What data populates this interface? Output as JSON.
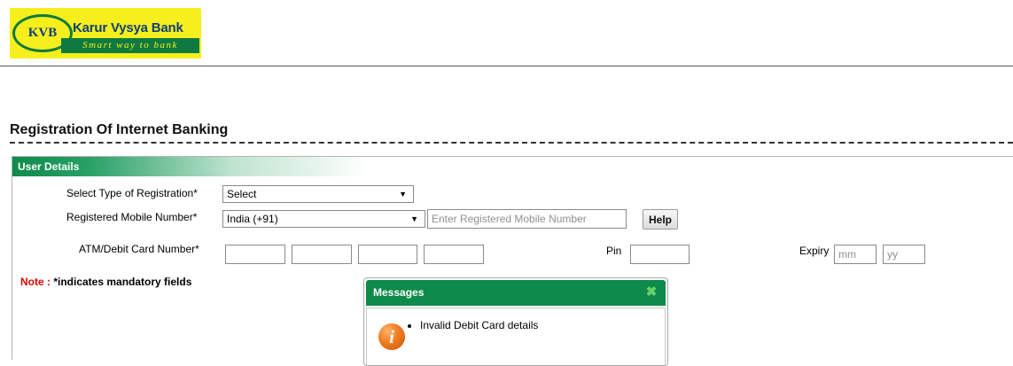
{
  "logo": {
    "badge": "KVB",
    "name": "Karur Vysya Bank",
    "tagline": "Smart way to bank"
  },
  "page_title": "Registration Of Internet Banking",
  "panel": {
    "title": "User Details"
  },
  "form": {
    "registration_type": {
      "label": "Select Type of Registration*",
      "value": "Select"
    },
    "mobile": {
      "label": "Registered Mobile Number*",
      "country_value": "India (+91)",
      "placeholder": "Enter Registered Mobile Number",
      "help_label": "Help"
    },
    "card": {
      "label": "ATM/Debit Card Number*",
      "pin_label": "Pin",
      "expiry_label": "Expiry",
      "month_placeholder": "mm",
      "year_placeholder": "yy"
    },
    "note": {
      "key": "Note :",
      "text": " *indicates mandatory fields"
    }
  },
  "dialog": {
    "title": "Messages",
    "close_icon": "close-icon",
    "info_icon": "info-icon",
    "messages": [
      "Invalid Debit Card details"
    ]
  },
  "colors": {
    "brand_green": "#0e8a4a",
    "brand_yellow": "#f6ef1c",
    "brand_blue": "#0f3f7a",
    "note_red": "#e00000",
    "info_orange": "#f07a1e"
  }
}
